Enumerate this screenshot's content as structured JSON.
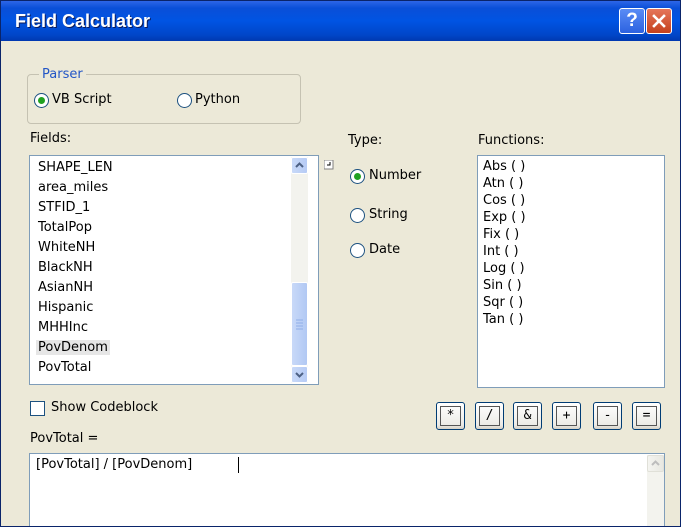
{
  "window": {
    "title": "Field Calculator",
    "help_glyph": "?"
  },
  "parser": {
    "legend": "Parser",
    "options": [
      {
        "label": "VB Script",
        "selected": true
      },
      {
        "label": "Python",
        "selected": false
      }
    ]
  },
  "fields": {
    "label": "Fields:",
    "items": [
      "SHAPE_LEN",
      "area_miles",
      "STFID_1",
      "TotalPop",
      "WhiteNH",
      "BlackNH",
      "AsianNH",
      "Hispanic",
      "MHHInc",
      "PovDenom",
      "PovTotal"
    ],
    "selected": "PovDenom"
  },
  "type": {
    "label": "Type:",
    "options": [
      {
        "label": "Number",
        "selected": true
      },
      {
        "label": "String",
        "selected": false
      },
      {
        "label": "Date",
        "selected": false
      }
    ]
  },
  "functions": {
    "label": "Functions:",
    "items": [
      "Abs ( )",
      "Atn ( )",
      "Cos ( )",
      "Exp ( )",
      "Fix ( )",
      "Int ( )",
      "Log ( )",
      "Sin ( )",
      "Sqr ( )",
      "Tan ( )"
    ]
  },
  "show_codeblock": {
    "label": "Show Codeblock",
    "checked": false
  },
  "operators": [
    "*",
    "/",
    "&",
    "+",
    "-",
    "="
  ],
  "expression": {
    "label": "PovTotal =",
    "value": "[PovTotal] / [PovDenom]"
  },
  "colors": {
    "titlebar": "#0054e3",
    "dialog_bg": "#ece9d8",
    "radio_dot": "#21a121",
    "legend_text": "#2356c6"
  }
}
